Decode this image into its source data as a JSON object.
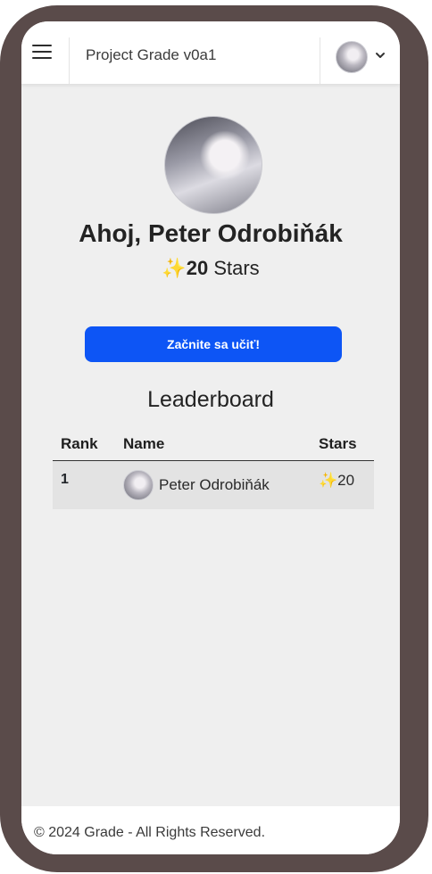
{
  "header": {
    "brand": "Project Grade v0a1",
    "menu_icon": "hamburger-icon",
    "user_menu_icon": "chevron-down-icon"
  },
  "profile": {
    "greeting": "Ahoj, Peter Odrobiňák",
    "star_icon": "✨",
    "stars_count": "20",
    "stars_label": "Stars"
  },
  "cta": {
    "label": "Začnite sa učiť!"
  },
  "leaderboard": {
    "title": "Leaderboard",
    "columns": {
      "rank": "Rank",
      "name": "Name",
      "stars": "Stars"
    },
    "rows": [
      {
        "rank": "1",
        "name": "Peter Odrobiňák",
        "star_icon": "✨",
        "stars": "20"
      }
    ]
  },
  "footer": {
    "text": "© 2024 Grade - All Rights Reserved."
  },
  "colors": {
    "primary_button": "#0d55f5",
    "page_background": "#efefef",
    "device_frame": "#5a4b4a",
    "star": "#f4b400"
  }
}
